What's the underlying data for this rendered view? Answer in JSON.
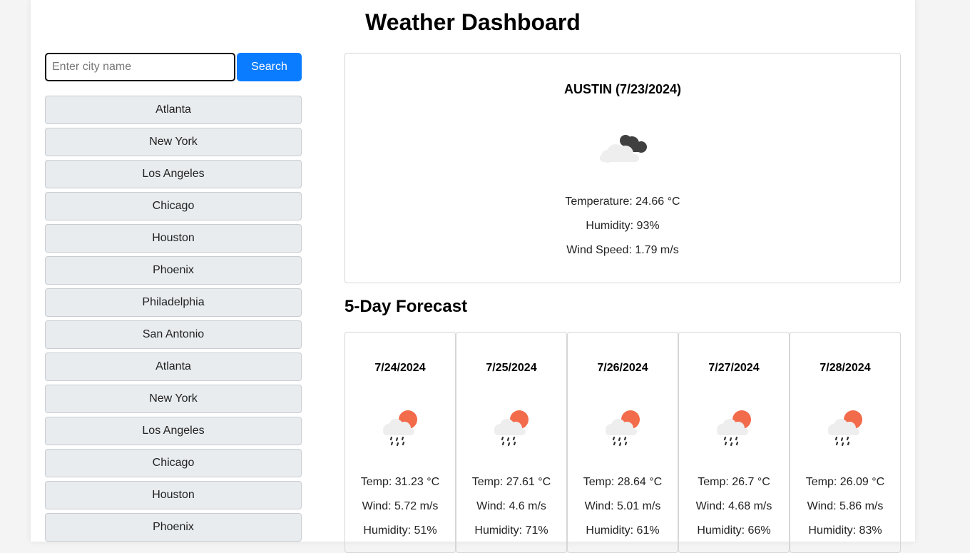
{
  "header": {
    "title": "Weather Dashboard"
  },
  "search": {
    "placeholder": "Enter city name",
    "value": "",
    "button_label": "Search"
  },
  "history": [
    "Atlanta",
    "New York",
    "Los Angeles",
    "Chicago",
    "Houston",
    "Phoenix",
    "Philadelphia",
    "San Antonio",
    "Atlanta",
    "New York",
    "Los Angeles",
    "Chicago",
    "Houston",
    "Phoenix"
  ],
  "current": {
    "title": "AUSTIN (7/23/2024)",
    "icon": "broken-clouds-icon",
    "temperature": "Temperature: 24.66 °C",
    "humidity": "Humidity: 93%",
    "wind": "Wind Speed: 1.79 m/s"
  },
  "forecast": {
    "heading": "5-Day Forecast",
    "days": [
      {
        "date": "7/24/2024",
        "icon": "sun-rain-icon",
        "temp": "Temp: 31.23 °C",
        "wind": "Wind: 5.72 m/s",
        "humidity": "Humidity: 51%"
      },
      {
        "date": "7/25/2024",
        "icon": "sun-rain-icon",
        "temp": "Temp: 27.61 °C",
        "wind": "Wind: 4.6 m/s",
        "humidity": "Humidity: 71%"
      },
      {
        "date": "7/26/2024",
        "icon": "sun-rain-icon",
        "temp": "Temp: 28.64 °C",
        "wind": "Wind: 5.01 m/s",
        "humidity": "Humidity: 61%"
      },
      {
        "date": "7/27/2024",
        "icon": "sun-rain-icon",
        "temp": "Temp: 26.7 °C",
        "wind": "Wind: 4.68 m/s",
        "humidity": "Humidity: 66%"
      },
      {
        "date": "7/28/2024",
        "icon": "sun-rain-icon",
        "temp": "Temp: 26.09 °C",
        "wind": "Wind: 5.86 m/s",
        "humidity": "Humidity: 83%"
      }
    ]
  },
  "colors": {
    "accent": "#0a7cff",
    "city_button_bg": "#e9ecef",
    "sun": "#f26b4a"
  }
}
